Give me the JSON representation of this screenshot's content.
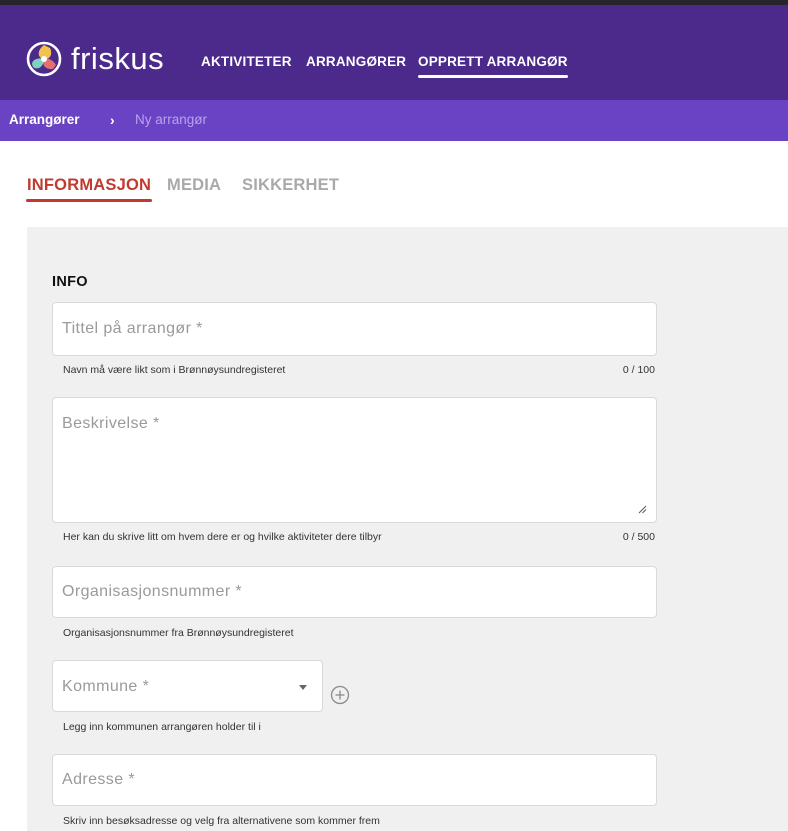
{
  "header": {
    "logo_text": "friskus",
    "nav": [
      {
        "label": "AKTIVITETER",
        "active": false
      },
      {
        "label": "ARRANGØRER",
        "active": false
      },
      {
        "label": "OPPRETT ARRANGØR",
        "active": true
      }
    ],
    "colors": {
      "bar": "#4b2a8c",
      "breadcrumb_bar": "#6a42c4"
    }
  },
  "breadcrumb": {
    "root": "Arrangører",
    "separator": "›",
    "current": "Ny arrangør"
  },
  "tabs": [
    {
      "label": "INFORMASJON",
      "active": true
    },
    {
      "label": "MEDIA",
      "active": false
    },
    {
      "label": "SIKKERHET",
      "active": false
    }
  ],
  "form": {
    "section_title": "INFO",
    "title_field": {
      "placeholder": "Tittel på arrangør *",
      "value": "",
      "helper": "Navn må være likt som i Brønnøysundregisteret",
      "counter": "0 / 100"
    },
    "description_field": {
      "placeholder": "Beskrivelse *",
      "value": "",
      "helper": "Her kan du skrive litt om hvem dere er og hvilke aktiviteter dere tilbyr",
      "counter": "0 / 500"
    },
    "org_number_field": {
      "placeholder": "Organisasjonsnummer *",
      "value": "",
      "helper": "Organisasjonsnummer fra Brønnøysundregisteret"
    },
    "municipality_field": {
      "placeholder": "Kommune *",
      "value": "",
      "helper": "Legg inn kommunen arrangøren holder til i",
      "add_icon": "plus-circle-icon"
    },
    "address_field": {
      "placeholder": "Adresse *",
      "value": "",
      "helper": "Skriv inn besøksadresse og velg fra alternativene som kommer frem"
    }
  },
  "accent_color": "#c23a2e"
}
